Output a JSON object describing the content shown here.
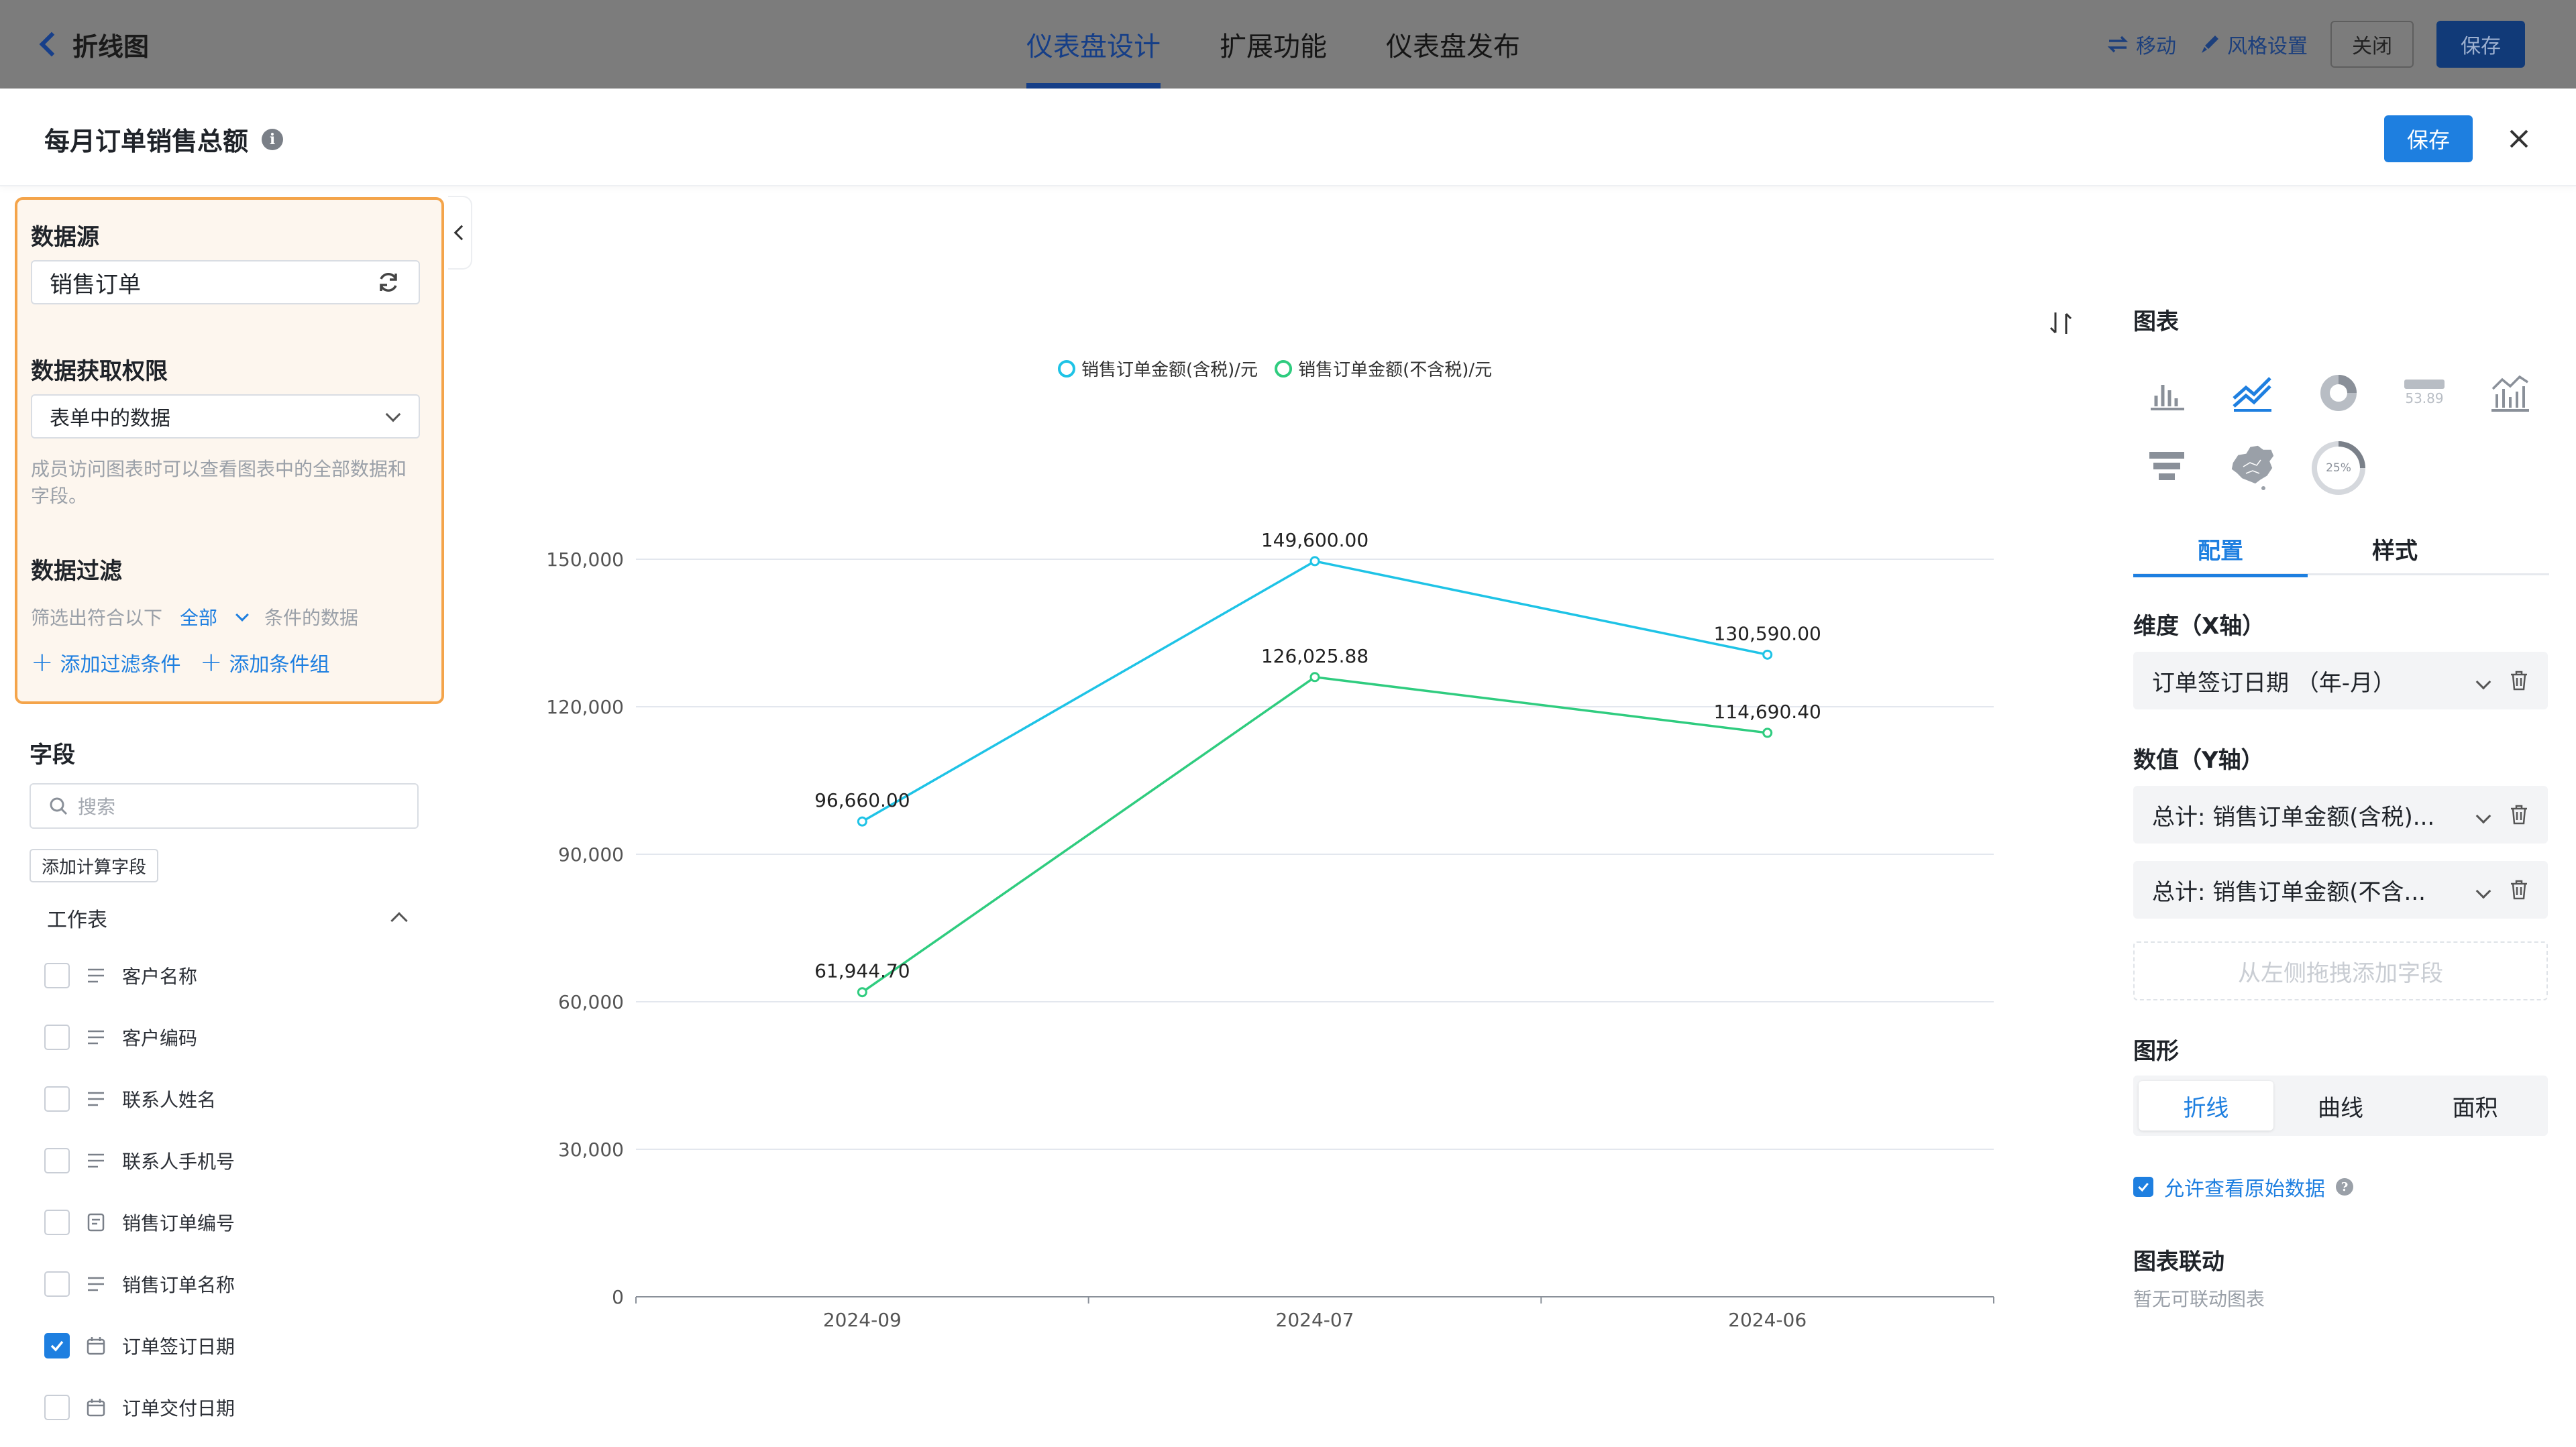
{
  "topbar": {
    "back_label": "折线图",
    "tabs": [
      {
        "label": "仪表盘设计",
        "active": true
      },
      {
        "label": "扩展功能",
        "active": false
      },
      {
        "label": "仪表盘发布",
        "active": false
      }
    ],
    "move_label": "移动",
    "style_label": "风格设置",
    "close_label": "关闭",
    "save_label": "保存"
  },
  "modal": {
    "title": "每月订单销售总额",
    "info_icon": "info-icon",
    "save_label": "保存",
    "close_icon": "close-icon"
  },
  "left": {
    "datasource_title": "数据源",
    "datasource_value": "销售订单",
    "permission_title": "数据获取权限",
    "permission_value": "表单中的数据",
    "permission_hint": "成员访问图表时可以查看图表中的全部数据和字段。",
    "filter_title": "数据过滤",
    "filter_prefix": "筛选出符合以下",
    "filter_mode": "全部",
    "filter_suffix": "条件的数据",
    "add_filter": "添加过滤条件",
    "add_group": "添加条件组",
    "fields_title": "字段",
    "search_placeholder": "搜索",
    "add_calc_field": "添加计算字段",
    "worksheet_label": "工作表",
    "fields": [
      {
        "label": "客户名称",
        "icon": "text-icon",
        "checked": false
      },
      {
        "label": "客户编码",
        "icon": "text-icon",
        "checked": false
      },
      {
        "label": "联系人姓名",
        "icon": "text-icon",
        "checked": false
      },
      {
        "label": "联系人手机号",
        "icon": "text-icon",
        "checked": false
      },
      {
        "label": "销售订单编号",
        "icon": "serial-number-icon",
        "checked": false
      },
      {
        "label": "销售订单名称",
        "icon": "text-icon",
        "checked": false
      },
      {
        "label": "订单签订日期",
        "icon": "calendar-icon",
        "checked": true
      },
      {
        "label": "订单交付日期",
        "icon": "calendar-icon",
        "checked": false
      }
    ]
  },
  "chart_data": {
    "type": "line",
    "categories": [
      "2024-09",
      "2024-07",
      "2024-06"
    ],
    "series": [
      {
        "name": "销售订单金额(含税)/元",
        "color": "#1ec3e6",
        "values": [
          96660.0,
          149600.0,
          130590.0
        ],
        "labels": [
          "96,660.00",
          "149,600.00",
          "130,590.00"
        ]
      },
      {
        "name": "销售订单金额(不含税)/元",
        "color": "#2fcc7f",
        "values": [
          61944.7,
          126025.88,
          114690.4
        ],
        "labels": [
          "61,944.70",
          "126,025.88",
          "114,690.40"
        ]
      }
    ],
    "ylim": [
      0,
      150000
    ],
    "yticks": [
      0,
      30000,
      60000,
      90000,
      120000,
      150000
    ],
    "ytick_labels": [
      "0",
      "30,000",
      "60,000",
      "90,000",
      "120,000",
      "150,000"
    ],
    "legend": "top-center",
    "grid": true
  },
  "right": {
    "chart_title": "图表",
    "chart_types": [
      {
        "icon": "bar-chart-icon",
        "selected": false
      },
      {
        "icon": "line-chart-icon",
        "selected": true
      },
      {
        "icon": "pie-chart-icon",
        "selected": false
      },
      {
        "icon": "indicator-card-icon",
        "selected": false,
        "text": "53.89"
      },
      {
        "icon": "combo-chart-icon",
        "selected": false
      },
      {
        "icon": "funnel-chart-icon",
        "selected": false
      },
      {
        "icon": "map-chart-icon",
        "selected": false
      },
      {
        "icon": "progress-chart-icon",
        "selected": false,
        "text": "25%"
      }
    ],
    "tab_config": "配置",
    "tab_style": "样式",
    "x_title": "维度（X轴）",
    "x_value": "订单签订日期 （年-月）",
    "y_title": "数值（Y轴）",
    "y_values": [
      "总计:  销售订单金额(含税)...",
      "总计:  销售订单金额(不含..."
    ],
    "drop_hint": "从左侧拖拽添加字段",
    "shape_title": "图形",
    "shape_options": [
      "折线",
      "曲线",
      "面积"
    ],
    "shape_selected": "折线",
    "allow_raw_label": "允许查看原始数据",
    "allow_raw_checked": true,
    "linkage_title": "图表联动",
    "linkage_hint": "暂无可联动图表",
    "accent": "#1e7fe0"
  }
}
